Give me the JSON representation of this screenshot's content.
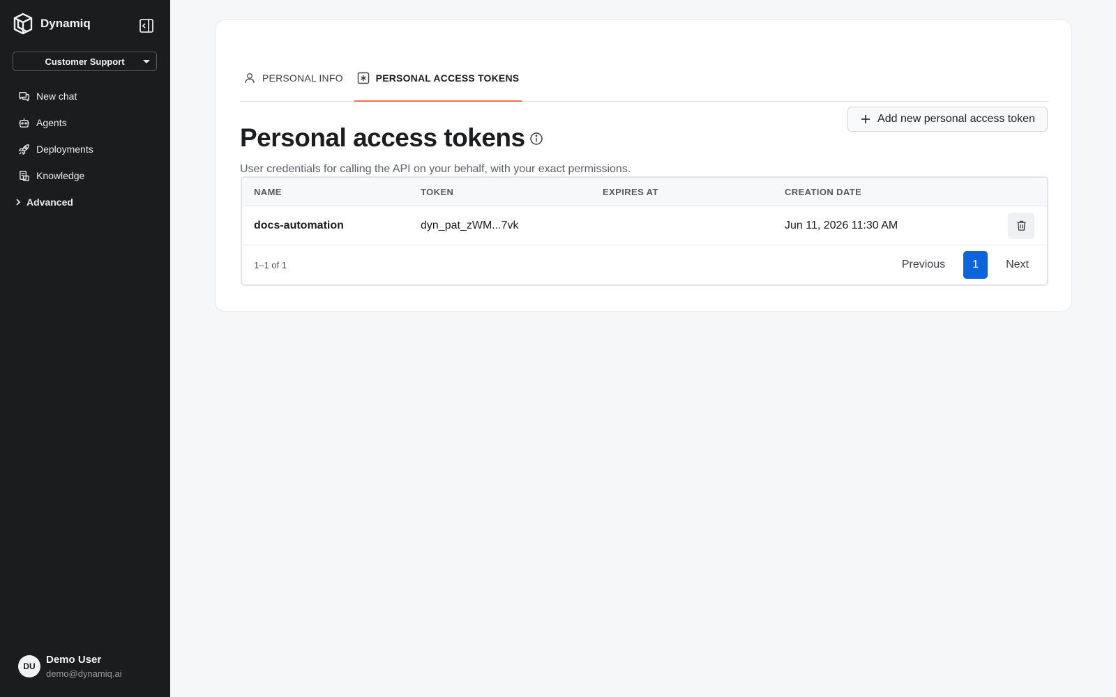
{
  "sidebar": {
    "brand_name": "Dynamiq",
    "workspace": "Customer Support",
    "nav": [
      {
        "label": "New chat",
        "icon": "chat-icon"
      },
      {
        "label": "Agents",
        "icon": "robot-icon"
      },
      {
        "label": "Deployments",
        "icon": "rocket-icon"
      },
      {
        "label": "Knowledge",
        "icon": "knowledge-icon"
      }
    ],
    "advanced_label": "Advanced",
    "user": {
      "initials": "DU",
      "name": "Demo User",
      "email": "demo@dynamiq.ai"
    }
  },
  "tabs": [
    {
      "label": "PERSONAL INFO",
      "icon": "user-icon",
      "active": false
    },
    {
      "label": "PERSONAL ACCESS TOKENS",
      "icon": "asterisk-box-icon",
      "active": true
    }
  ],
  "page": {
    "title": "Personal access tokens",
    "subtitle": "User credentials for calling the API on your behalf, with your exact permissions.",
    "add_button": "Add new personal access token"
  },
  "table": {
    "columns": [
      "NAME",
      "TOKEN",
      "EXPIRES AT",
      "CREATION DATE"
    ],
    "rows": [
      {
        "name": "docs-automation",
        "token": "dyn_pat_zWM...7vk",
        "expires_at": "",
        "creation_date": "Jun 11, 2026 11:30 AM"
      }
    ],
    "range_text": "1–1 of 1",
    "pagination": {
      "previous": "Previous",
      "current": "1",
      "next": "Next"
    }
  },
  "colors": {
    "sidebar_bg": "#1b1c1e",
    "accent_tab": "#ee6b50",
    "primary": "#0d66d9"
  }
}
